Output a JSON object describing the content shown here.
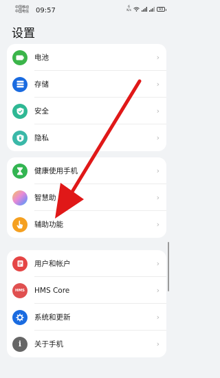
{
  "status_bar": {
    "carrier_1": "中国移动",
    "carrier_2": "中国电信",
    "time": "09:57",
    "speed_value": "6",
    "speed_unit": "K/s",
    "battery": "93"
  },
  "page_title": "设置",
  "groups": [
    {
      "items": [
        {
          "label": "电池",
          "icon": "battery-icon",
          "color": "#3bb54a"
        },
        {
          "label": "存储",
          "icon": "storage-icon",
          "color": "#1a6be0"
        },
        {
          "label": "安全",
          "icon": "shield-icon",
          "color": "#2fb894"
        },
        {
          "label": "隐私",
          "icon": "privacy-icon",
          "color": "#3ab8a8"
        }
      ]
    },
    {
      "items": [
        {
          "label": "健康使用手机",
          "icon": "hourglass-icon",
          "color": "#33b552"
        },
        {
          "label": "智慧助",
          "icon": "smart-assistant-icon",
          "color": "#e0a0e0"
        },
        {
          "label": "辅助功能",
          "icon": "hand-icon",
          "color": "#f5a020"
        }
      ]
    },
    {
      "items": [
        {
          "label": "用户和帐户",
          "icon": "user-icon",
          "color": "#e54545"
        },
        {
          "label": "HMS Core",
          "icon": "hms-icon",
          "color": "#e05050",
          "badge": "HMS"
        },
        {
          "label": "系统和更新",
          "icon": "system-icon",
          "color": "#1a6be0"
        },
        {
          "label": "关于手机",
          "icon": "info-icon",
          "color": "#666666"
        }
      ]
    }
  ],
  "annotation_color": "#e01818"
}
